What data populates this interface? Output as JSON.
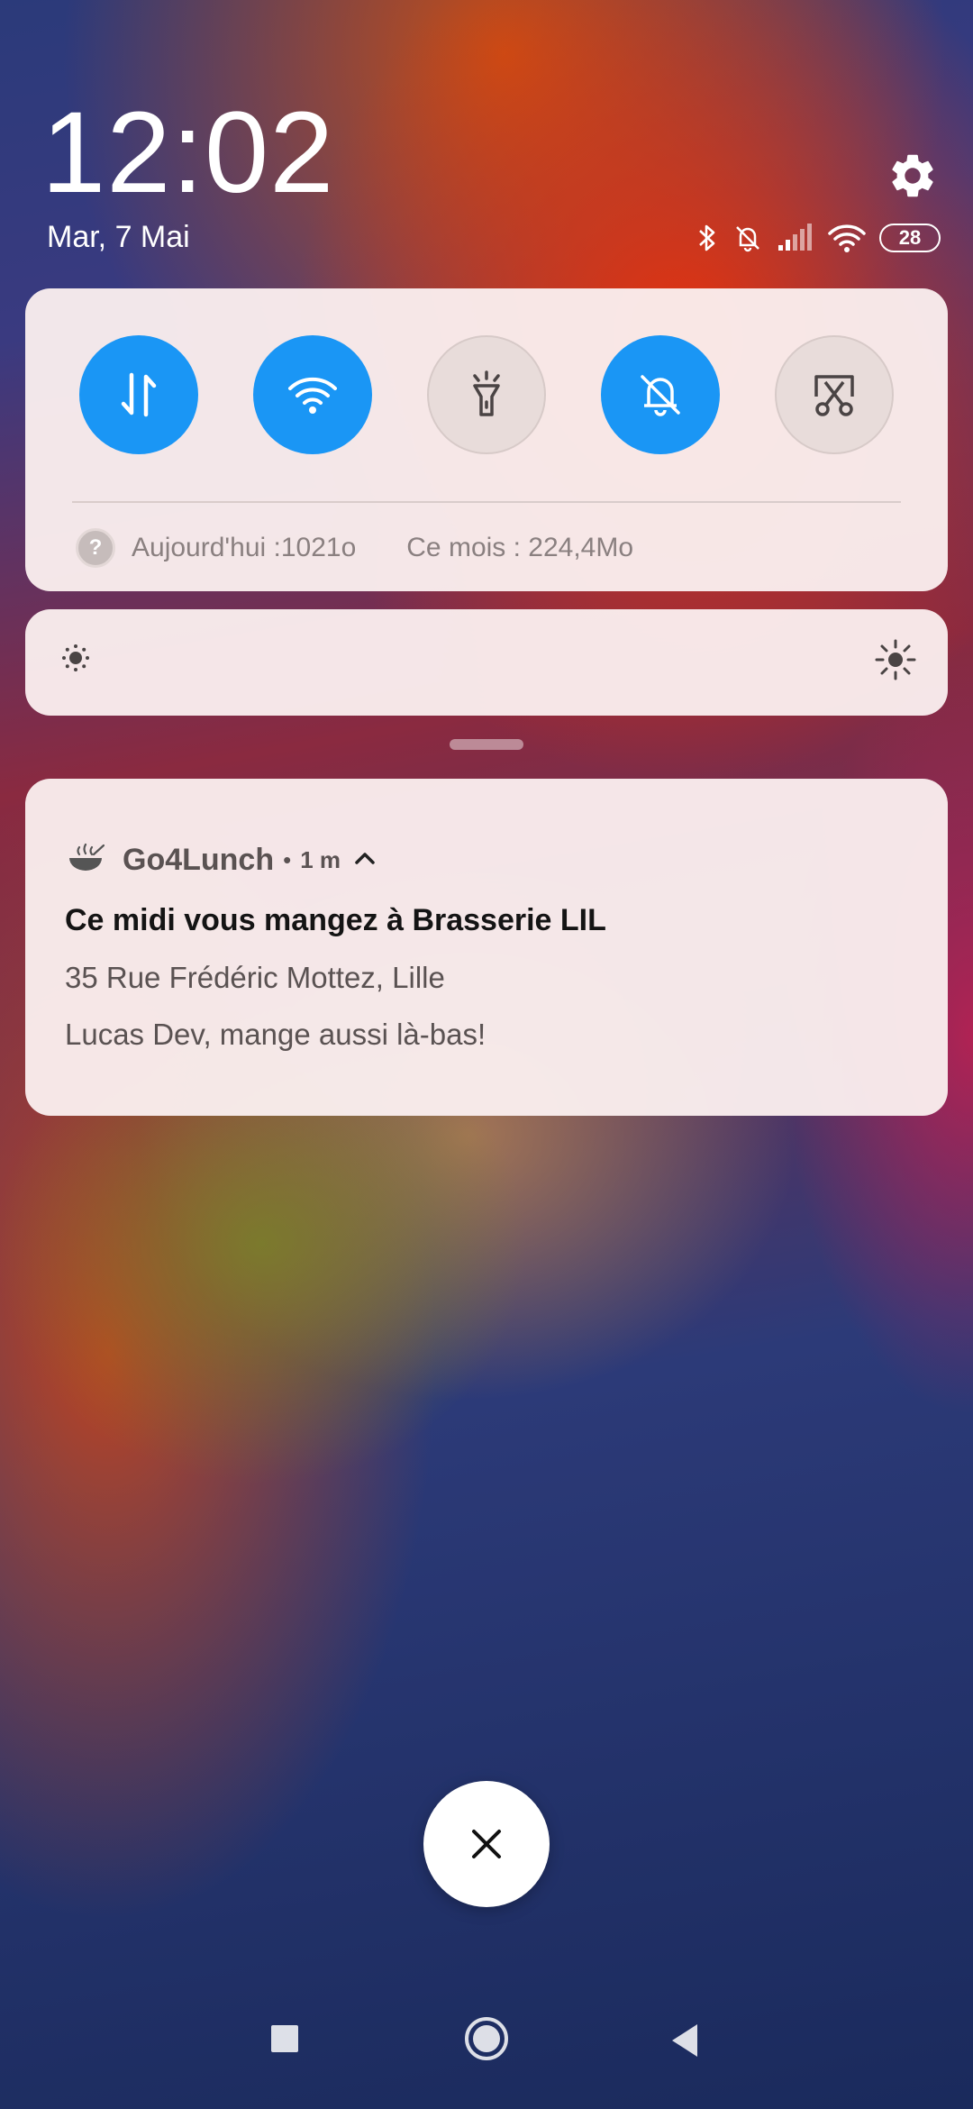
{
  "status": {
    "time": "12:02",
    "date": "Mar, 7 Mai",
    "battery": "28",
    "icons": [
      "bluetooth-icon",
      "bell-muted-icon",
      "signal-icon",
      "wifi-icon",
      "battery-icon"
    ]
  },
  "quick_settings": {
    "toggles": [
      {
        "name": "mobile-data",
        "icon": "data-arrows-icon",
        "state": "on"
      },
      {
        "name": "wifi",
        "icon": "wifi-icon",
        "state": "on"
      },
      {
        "name": "flashlight",
        "icon": "flashlight-icon",
        "state": "off"
      },
      {
        "name": "silent",
        "icon": "bell-muted-icon",
        "state": "on"
      },
      {
        "name": "screenshot",
        "icon": "scissors-icon",
        "state": "off"
      }
    ],
    "usage_today": "Aujourd'hui :1021o",
    "usage_month": "Ce mois : 224,4Mo",
    "help_symbol": "?",
    "accent_color": "#1a96f5"
  },
  "brightness": {
    "low_icon": "brightness-low-icon",
    "high_icon": "brightness-high-icon"
  },
  "notification": {
    "app_name": "Go4Lunch",
    "separator": "•",
    "time": "1 m",
    "title": "Ce midi vous mangez à Brasserie LIL",
    "address": "35 Rue Frédéric Mottez, Lille",
    "message": "Lucas Dev, mange aussi là-bas!"
  },
  "navigation": {
    "buttons": [
      "recent-apps",
      "home",
      "back"
    ]
  }
}
